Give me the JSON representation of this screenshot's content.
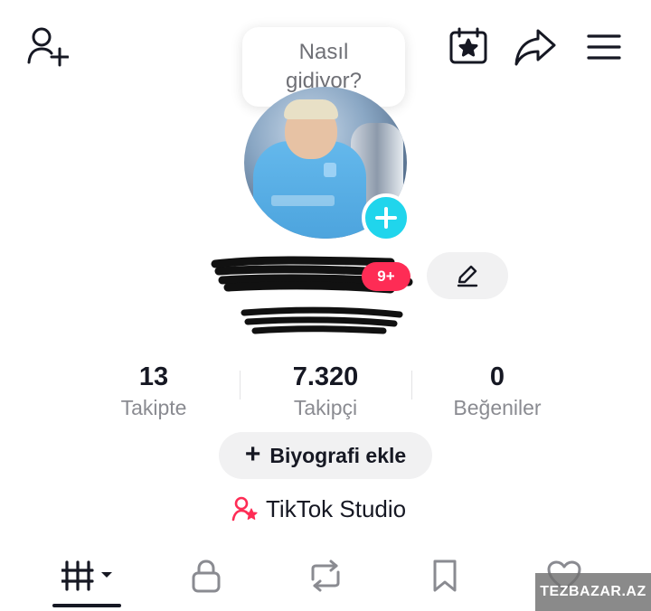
{
  "header": {
    "bubble_line1": "Nasıl",
    "bubble_line2": "gidiyor?"
  },
  "profile": {
    "notification_badge": "9+"
  },
  "stats": [
    {
      "value": "13",
      "label": "Takipte"
    },
    {
      "value": "7.320",
      "label": "Takipçi"
    },
    {
      "value": "0",
      "label": "Beğeniler"
    }
  ],
  "actions": {
    "bio_button_plus": "+",
    "bio_button_label": "Biyografi ekle",
    "studio_label": "TikTok Studio"
  },
  "tabs": [
    {
      "icon": "videos-grid-icon",
      "active": true
    },
    {
      "icon": "lock-icon",
      "active": false
    },
    {
      "icon": "repost-icon",
      "active": false
    },
    {
      "icon": "bookmark-icon",
      "active": false
    },
    {
      "icon": "heart-icon",
      "active": false
    }
  ],
  "watermark": {
    "text": "TEZBAZAR.AZ"
  },
  "colors": {
    "accent_pink": "#fe2c55",
    "accent_cyan": "#20d5ec",
    "text_primary": "#161823",
    "text_secondary": "#8a8b91",
    "button_bg": "#f1f1f2"
  }
}
